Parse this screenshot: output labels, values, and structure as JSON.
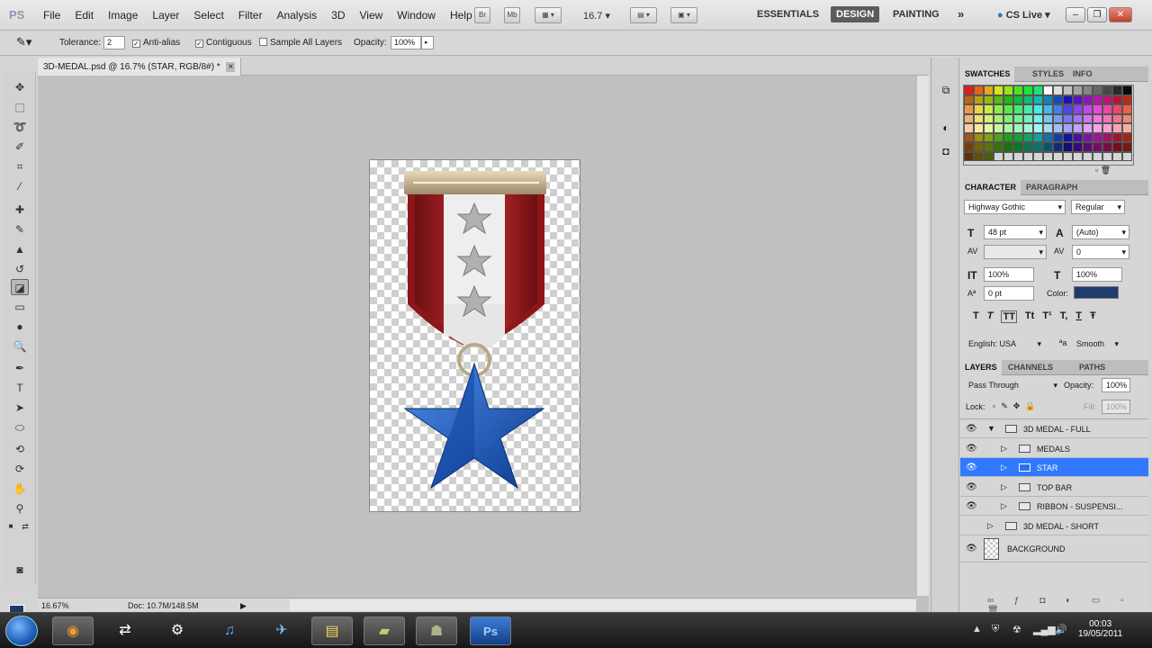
{
  "app": {
    "logo": "PS"
  },
  "menu": [
    "File",
    "Edit",
    "Image",
    "Layer",
    "Select",
    "Filter",
    "Analysis",
    "3D",
    "View",
    "Window",
    "Help"
  ],
  "menubar": {
    "br": "Br",
    "mb": "Mb",
    "zoom": "16.7",
    "workspaces": [
      "ESSENTIALS",
      "DESIGN",
      "PAINTING"
    ],
    "more": "»",
    "cslive": "CS Live"
  },
  "options": {
    "tolerance_label": "Tolerance:",
    "tolerance": "2",
    "antialias": "Anti-alias",
    "contiguous": "Contiguous",
    "sample_all": "Sample All Layers",
    "opacity_label": "Opacity:",
    "opacity": "100%"
  },
  "document": {
    "tab_title": "3D-MEDAL.psd @ 16.7% (STAR, RGB/8#) *",
    "close": "×",
    "zoom": "16.67%",
    "doc_size": "Doc: 10.7M/148.5M"
  },
  "swatch_panel": {
    "tabs": [
      "SWATCHES",
      "STYLES",
      "INFO"
    ]
  },
  "character": {
    "tabs": [
      "CHARACTER",
      "PARAGRAPH"
    ],
    "font": "Highway Gothic",
    "style": "Regular",
    "size": "48 pt",
    "leading": "(Auto)",
    "kerning": "",
    "tracking": "0",
    "vscale": "100%",
    "hscale": "100%",
    "baseline": "0 pt",
    "color_label": "Color:",
    "color": "#1f3c6e",
    "type_buttons": [
      "T",
      "T",
      "TT",
      "Tt",
      "T¹",
      "T,",
      "T",
      "Ŧ"
    ],
    "language": "English: USA",
    "aa_icon": "ªa",
    "antialias": "Smooth"
  },
  "layers": {
    "tabs": [
      "LAYERS",
      "CHANNELS",
      "PATHS"
    ],
    "blend": "Pass Through",
    "opacity_label": "Opacity:",
    "opacity": "100%",
    "lock_label": "Lock:",
    "fill_label": "Fill:",
    "fill": "100%",
    "items": [
      {
        "name": "3D MEDAL - FULL",
        "indent": 0,
        "open": true,
        "visible": true,
        "selected": false
      },
      {
        "name": "MEDALS",
        "indent": 1,
        "open": false,
        "visible": true,
        "selected": false
      },
      {
        "name": "STAR",
        "indent": 1,
        "open": false,
        "visible": true,
        "selected": true
      },
      {
        "name": "TOP BAR",
        "indent": 1,
        "open": false,
        "visible": true,
        "selected": false
      },
      {
        "name": "RIBBON - SUSPENSI...",
        "indent": 1,
        "open": false,
        "visible": true,
        "selected": false
      },
      {
        "name": "3D MEDAL - SHORT",
        "indent": 0,
        "open": false,
        "visible": false,
        "selected": false
      },
      {
        "name": "BACKGROUND",
        "indent": 0,
        "open": false,
        "visible": true,
        "selected": false
      }
    ]
  },
  "taskbar": {
    "time": "00:03",
    "date": "19/05/2011"
  }
}
